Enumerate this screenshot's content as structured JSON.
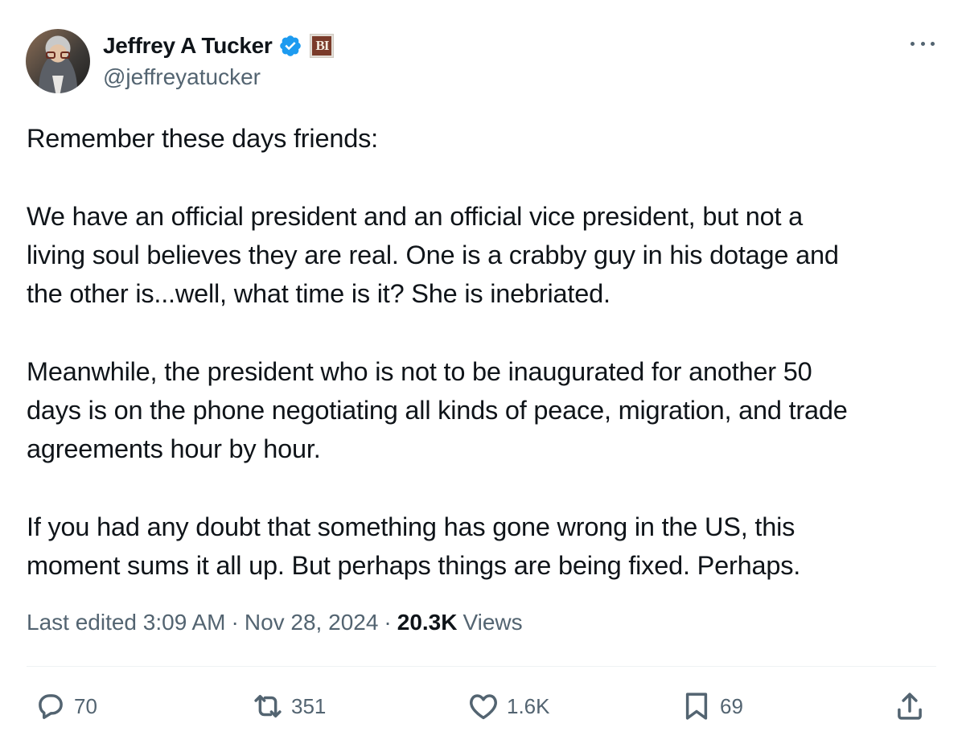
{
  "author": {
    "name": "Jeffrey A Tucker",
    "handle": "@jeffreyatucker",
    "org_badge_text": "BI",
    "verified_color": "#1d9bf0"
  },
  "tweet": {
    "paragraphs": [
      [
        "Remember these days friends:"
      ],
      [
        "We have an official president and an official vice president, but not a",
        "living soul believes they are real. One is a crabby guy in his dotage and",
        "the other is...well, what time is it? She is inebriated."
      ],
      [
        "Meanwhile, the president who is not to be inaugurated for another 50",
        "days is on the phone negotiating all kinds of peace, migration, and trade",
        "agreements hour by hour."
      ],
      [
        "If you had any doubt that something has gone wrong in the US, this",
        "moment sums it all up. But perhaps things are being fixed. Perhaps."
      ]
    ]
  },
  "meta": {
    "edited_label": "Last edited 3:09 AM",
    "date": "Nov 28, 2024",
    "views_count": "20.3K",
    "views_label": "Views",
    "separator": "·"
  },
  "actions": {
    "replies": "70",
    "reposts": "351",
    "likes": "1.6K",
    "bookmarks": "69"
  },
  "icons": {
    "more": "more-horizontal-icon",
    "reply": "reply-bubble-icon",
    "repost": "repost-arrows-icon",
    "like": "heart-icon",
    "bookmark": "bookmark-icon",
    "share": "share-upload-icon",
    "verified": "verified-badge-icon"
  },
  "colors": {
    "text": "#0f1419",
    "secondary": "#536471",
    "divider": "#eff3f4",
    "org_badge": "#7a3b2a"
  }
}
